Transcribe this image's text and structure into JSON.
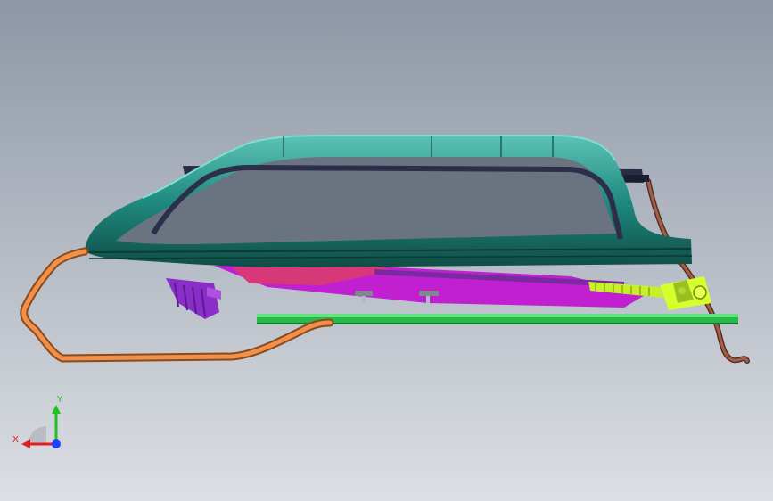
{
  "viewport": {
    "background_top": "#8d97a5",
    "background_bottom": "#dcdfe4"
  },
  "model": {
    "colors": {
      "outer_frame": "#1f8a80",
      "outer_frame_highlight": "#5ec2b6",
      "outer_frame_shadow": "#0f4d46",
      "glass_panel": "#e600e6",
      "inner_seal": "#3a3d6a",
      "underside": "#c43ca0",
      "drive_cable": "#e8823c",
      "drain_tube": "#8a4a3a",
      "front_rail": "#2ecc55",
      "motor": "#d6ff2e",
      "bracket": "#9b30d0"
    }
  },
  "triad": {
    "axes": [
      {
        "label": "Y",
        "color": "#20c020"
      },
      {
        "label": "X",
        "color": "#e02020"
      }
    ],
    "origin_color": "#2040ff"
  }
}
